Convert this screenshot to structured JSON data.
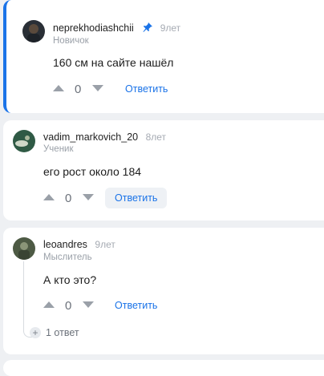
{
  "comments": [
    {
      "author": "neprekhodiashchii",
      "time": "9лет",
      "rank": "Новичок",
      "text": "160 см на сайте нашёл",
      "score": "0",
      "reply_label": "Ответить",
      "pinned": true,
      "avatar_colors": [
        "#2a2f36",
        "#5a4a3c"
      ]
    },
    {
      "author": "vadim_markovich_20",
      "time": "8лет",
      "rank": "Ученик",
      "text": "его рост около 184",
      "score": "0",
      "reply_label": "Ответить",
      "avatar_colors": [
        "#2f5a45",
        "#cfd8c8"
      ]
    },
    {
      "author": "leoandres",
      "time": "9лет",
      "rank": "Мыслитель",
      "text": "А кто это?",
      "score": "0",
      "reply_label": "Ответить",
      "replies_label": "1 ответ",
      "avatar_colors": [
        "#4d5a44",
        "#8a9578"
      ]
    }
  ],
  "icons": {
    "pin": "pin-icon",
    "upvote": "arrow-up-icon",
    "downvote": "arrow-down-icon",
    "expand": "plus-icon"
  },
  "colors": {
    "accent": "#1a73e8",
    "background": "#eef0f3"
  }
}
